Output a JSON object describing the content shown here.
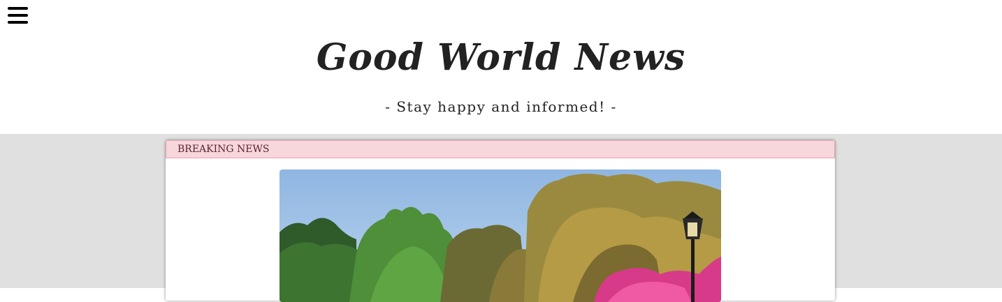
{
  "header": {
    "menu_icon": "hamburger-menu-icon",
    "title": "Good World News",
    "tagline": "- Stay happy and informed! -"
  },
  "breaking_news": {
    "label": "BREAKING NEWS",
    "image": "park-with-trees-and-azaleas-photo"
  },
  "colors": {
    "page_background": "#e0e0e0",
    "breaking_header_bg": "#f7d6dc",
    "breaking_header_border": "#e8a3b0"
  }
}
